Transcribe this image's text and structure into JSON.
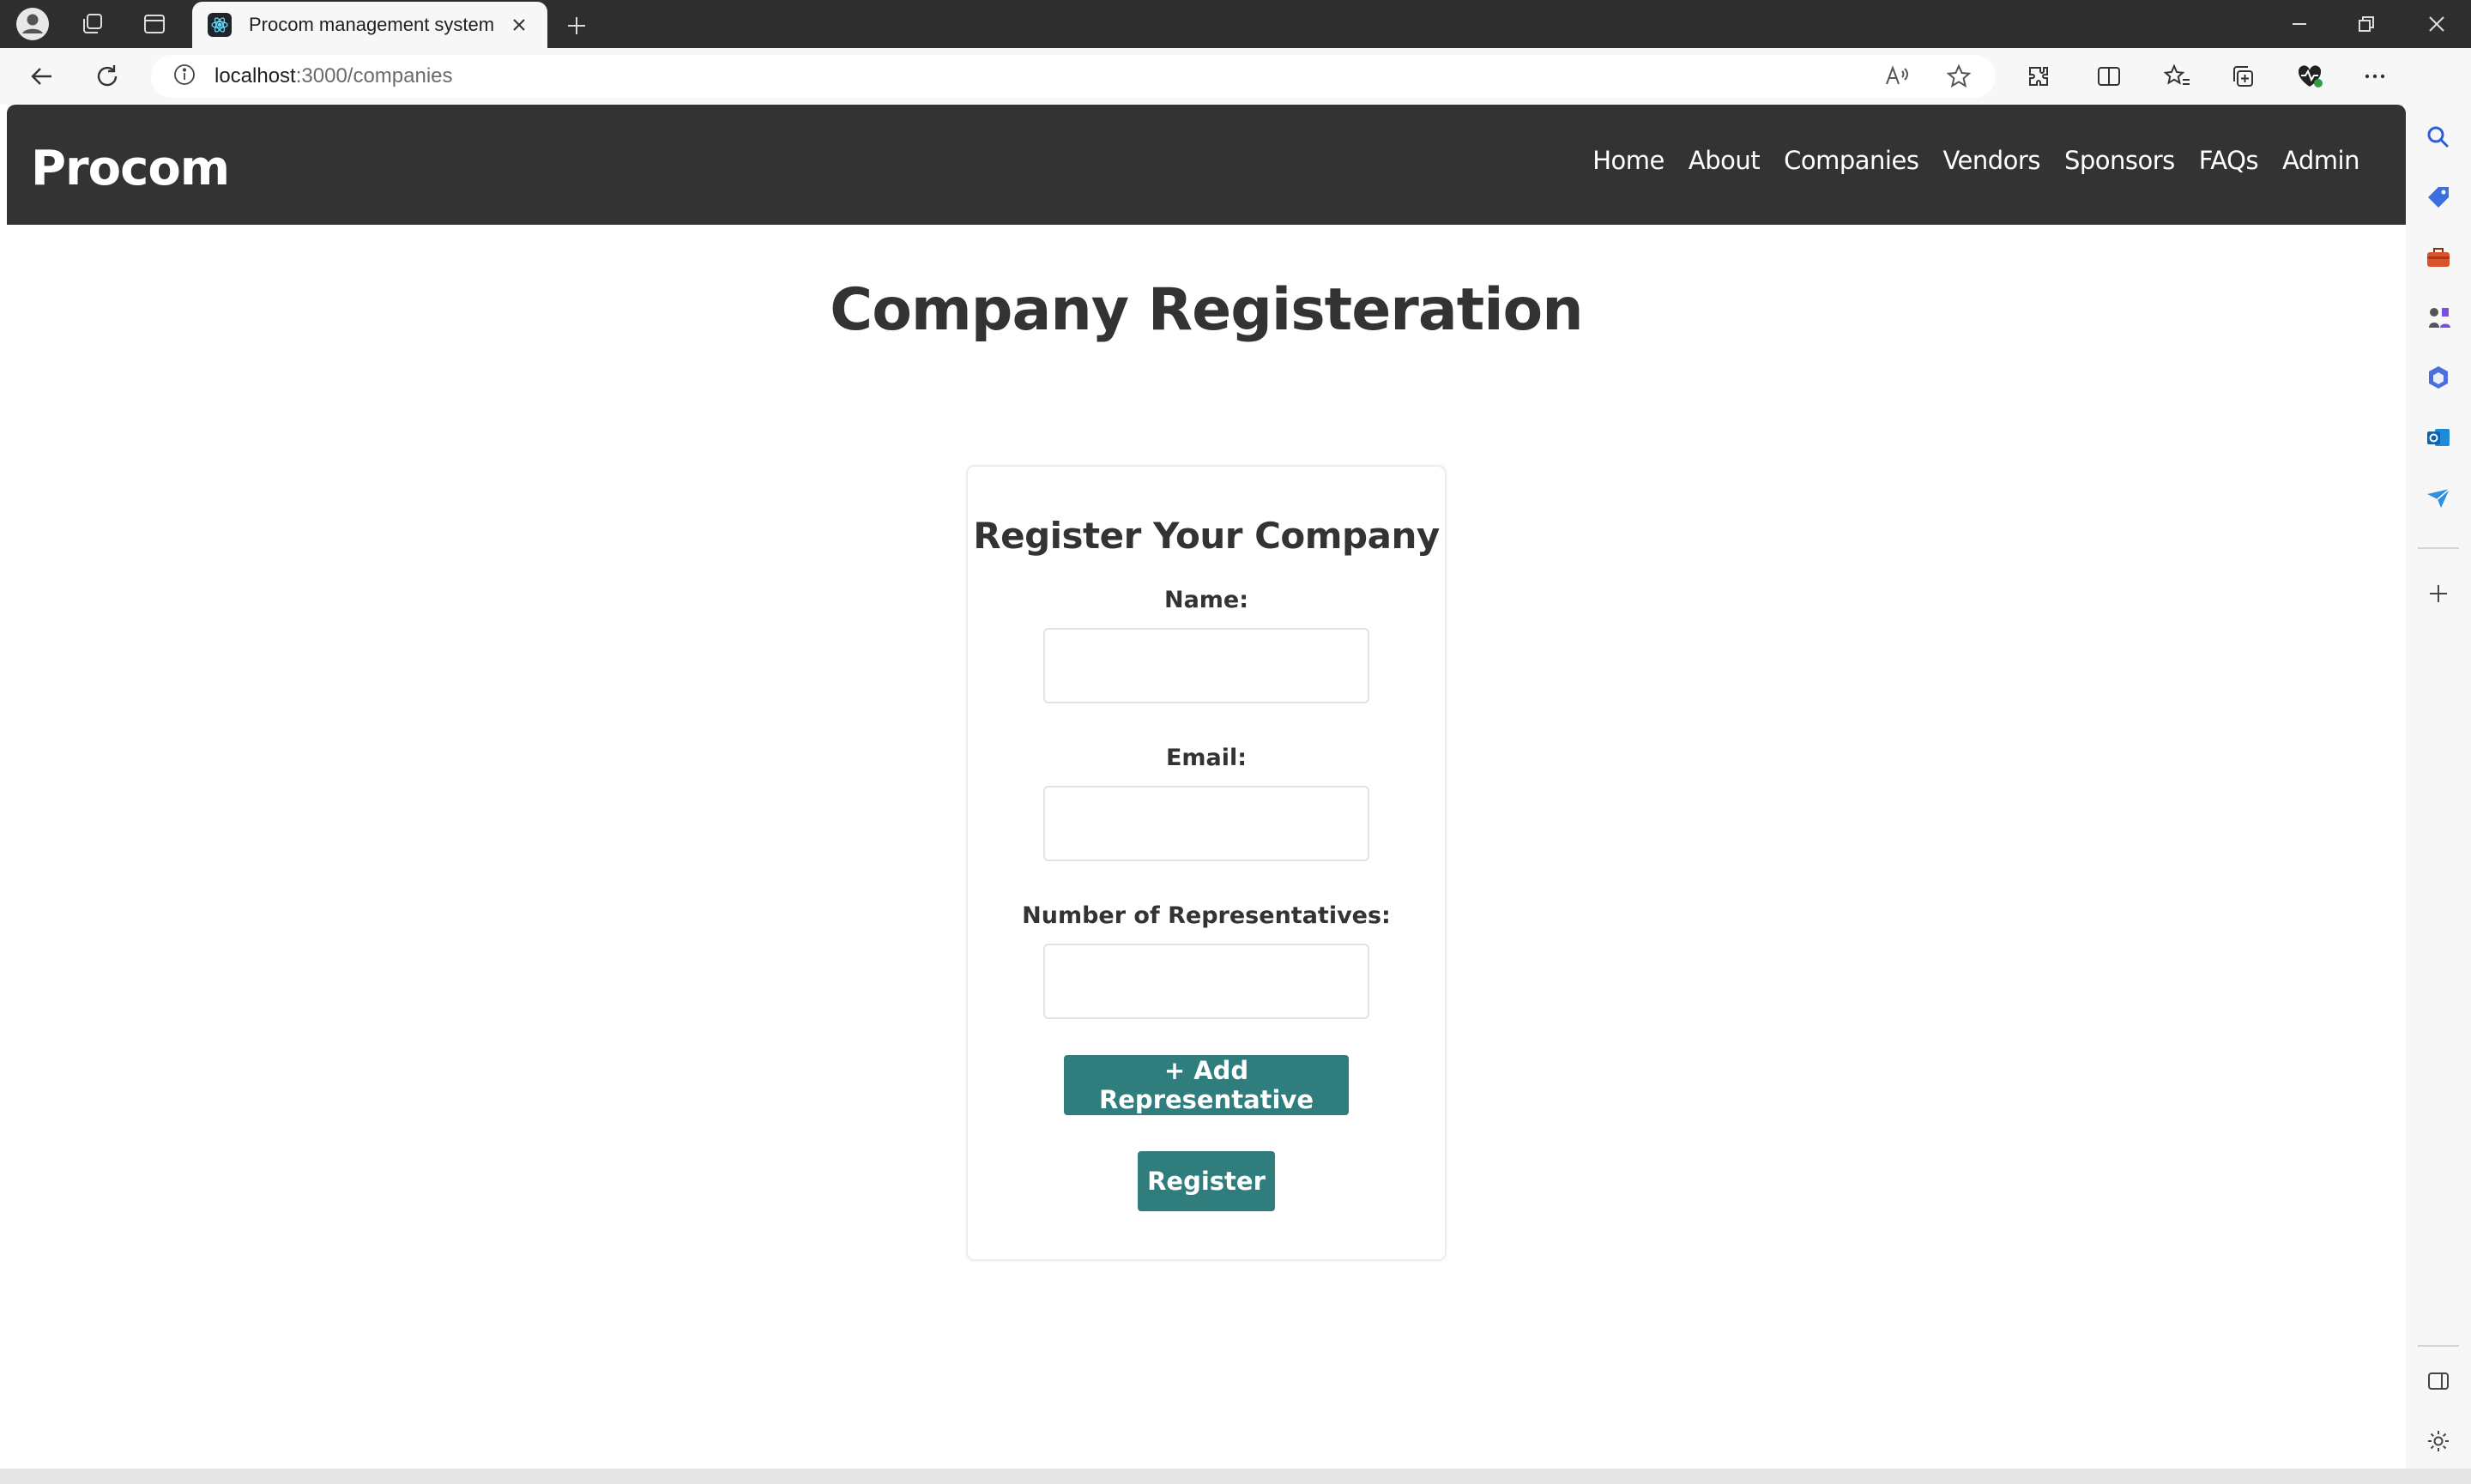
{
  "browser": {
    "tab_title": "Procom management system",
    "url_host": "localhost",
    "url_path": ":3000/companies"
  },
  "navbar": {
    "brand": "Procom",
    "links": [
      "Home",
      "About",
      "Companies",
      "Vendors",
      "Sponsors",
      "FAQs",
      "Admin"
    ]
  },
  "page": {
    "title": "Company Registeration"
  },
  "form": {
    "heading": "Register Your Company",
    "name_label": "Name:",
    "name_value": "",
    "email_label": "Email:",
    "email_value": "",
    "reps_label": "Number of Representatives:",
    "reps_value": "",
    "add_rep_button": "+ Add Representative",
    "register_button": "Register"
  },
  "colors": {
    "navbar_bg": "#333333",
    "button_bg": "#2f7d7c",
    "chrome_dark": "#2e2e2e"
  }
}
